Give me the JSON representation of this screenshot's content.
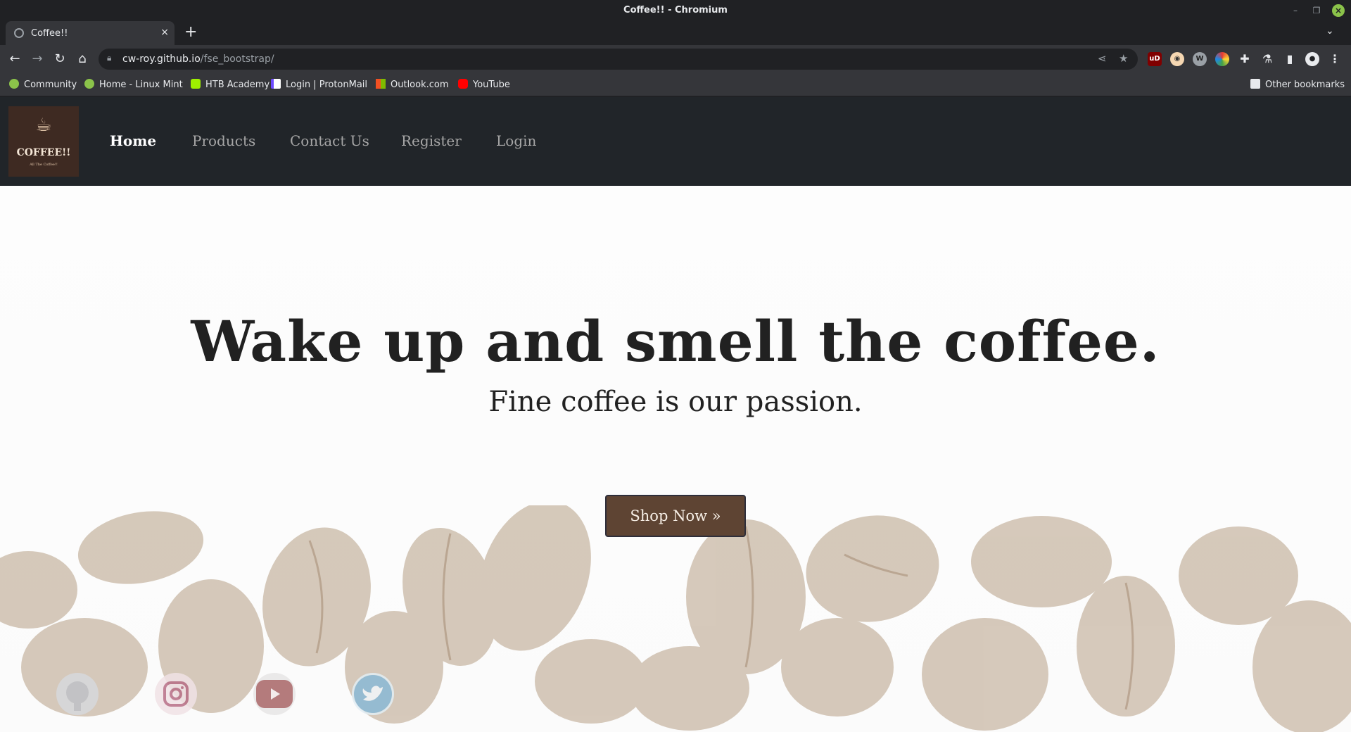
{
  "window": {
    "title": "Coffee!! - Chromium"
  },
  "tab": {
    "title": "Coffee!!"
  },
  "address_bar": {
    "host": "cw-roy.github.io",
    "path": "/fse_bootstrap/"
  },
  "bookmarks": [
    {
      "label": "Community",
      "icon": "linux-mint-icon"
    },
    {
      "label": "Home - Linux Mint",
      "icon": "linux-mint-icon"
    },
    {
      "label": "HTB Academy",
      "icon": "htb-cube-icon"
    },
    {
      "label": "Login | ProtonMail",
      "icon": "protonmail-icon"
    },
    {
      "label": "Outlook.com",
      "icon": "microsoft-icon"
    },
    {
      "label": "YouTube",
      "icon": "youtube-icon"
    }
  ],
  "other_bookmarks": "Other bookmarks",
  "site": {
    "logo": {
      "title": "COFFEE!!",
      "tagline": "All The Coffee!!"
    },
    "nav": [
      "Home",
      "Products",
      "Contact Us",
      "Register",
      "Login"
    ],
    "active_nav": "Home",
    "headline": "Wake up and smell the coffee.",
    "subheadline": "Fine coffee is our passion.",
    "cta": "Shop Now »",
    "social": [
      "github-icon",
      "instagram-icon",
      "youtube-icon",
      "twitter-icon"
    ]
  },
  "colors": {
    "nav_bg": "#212529",
    "button_bg": "#5e4433",
    "hero_bg": "#fcfcfc"
  }
}
